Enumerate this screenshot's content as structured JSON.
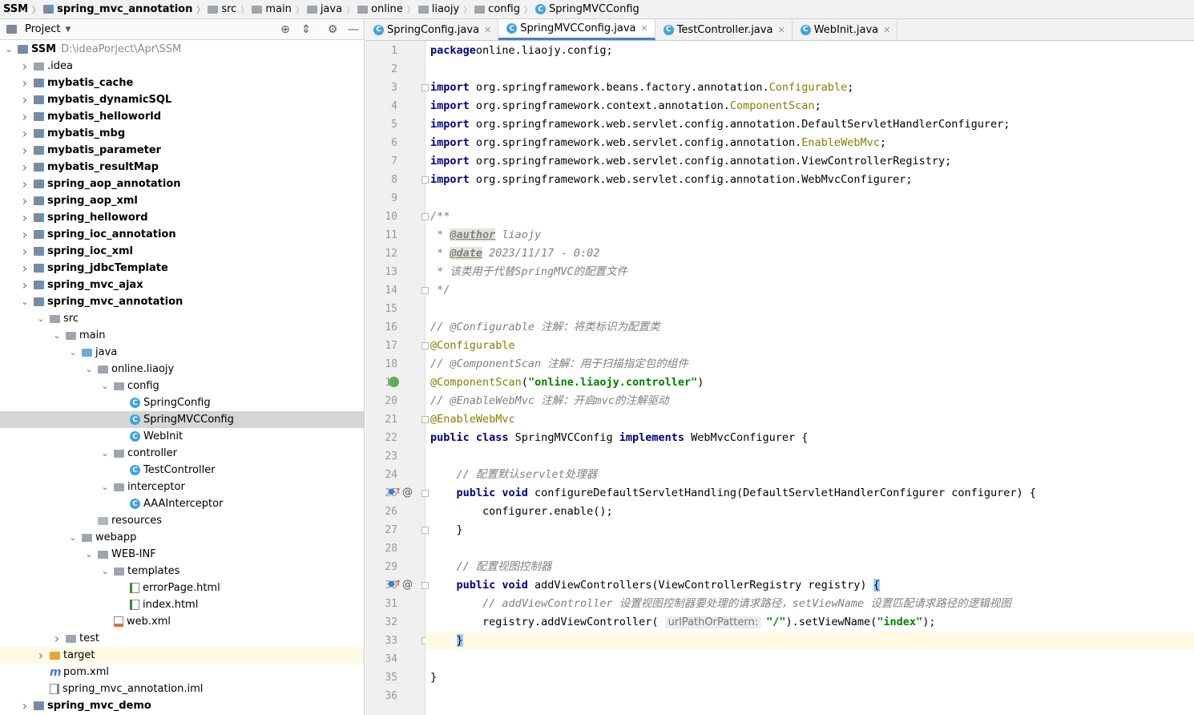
{
  "breadcrumb": [
    "SSM",
    "spring_mvc_annotation",
    "src",
    "main",
    "java",
    "online",
    "liaojy",
    "config",
    "SpringMVCConfig"
  ],
  "project_panel": {
    "title": "Project"
  },
  "tree": [
    {
      "label": "SSM",
      "path": "D:\\ideaPorject\\Apr\\SSM",
      "depth": 0,
      "expand": "open",
      "icon": "module",
      "bold": true
    },
    {
      "label": ".idea",
      "depth": 1,
      "expand": "closed",
      "icon": "folder"
    },
    {
      "label": "mybatis_cache",
      "depth": 1,
      "expand": "closed",
      "icon": "module",
      "bold": true
    },
    {
      "label": "mybatis_dynamicSQL",
      "depth": 1,
      "expand": "closed",
      "icon": "module",
      "bold": true
    },
    {
      "label": "mybatis_helloworld",
      "depth": 1,
      "expand": "closed",
      "icon": "module",
      "bold": true
    },
    {
      "label": "mybatis_mbg",
      "depth": 1,
      "expand": "closed",
      "icon": "module",
      "bold": true
    },
    {
      "label": "mybatis_parameter",
      "depth": 1,
      "expand": "closed",
      "icon": "module",
      "bold": true
    },
    {
      "label": "mybatis_resultMap",
      "depth": 1,
      "expand": "closed",
      "icon": "module",
      "bold": true
    },
    {
      "label": "spring_aop_annotation",
      "depth": 1,
      "expand": "closed",
      "icon": "module",
      "bold": true
    },
    {
      "label": "spring_aop_xml",
      "depth": 1,
      "expand": "closed",
      "icon": "module",
      "bold": true
    },
    {
      "label": "spring_helloword",
      "depth": 1,
      "expand": "closed",
      "icon": "module",
      "bold": true
    },
    {
      "label": "spring_ioc_annotation",
      "depth": 1,
      "expand": "closed",
      "icon": "module",
      "bold": true
    },
    {
      "label": "spring_ioc_xml",
      "depth": 1,
      "expand": "closed",
      "icon": "module",
      "bold": true
    },
    {
      "label": "spring_jdbcTemplate",
      "depth": 1,
      "expand": "closed",
      "icon": "module",
      "bold": true
    },
    {
      "label": "spring_mvc_ajax",
      "depth": 1,
      "expand": "closed",
      "icon": "module",
      "bold": true
    },
    {
      "label": "spring_mvc_annotation",
      "depth": 1,
      "expand": "open",
      "icon": "module",
      "bold": true
    },
    {
      "label": "src",
      "depth": 2,
      "expand": "open",
      "icon": "folder"
    },
    {
      "label": "main",
      "depth": 3,
      "expand": "open",
      "icon": "folder"
    },
    {
      "label": "java",
      "depth": 4,
      "expand": "open",
      "icon": "folder-blue"
    },
    {
      "label": "online.liaojy",
      "depth": 5,
      "expand": "open",
      "icon": "package"
    },
    {
      "label": "config",
      "depth": 6,
      "expand": "open",
      "icon": "package"
    },
    {
      "label": "SpringConfig",
      "depth": 7,
      "expand": "none",
      "icon": "class"
    },
    {
      "label": "SpringMVCConfig",
      "depth": 7,
      "expand": "none",
      "icon": "class",
      "selected": true
    },
    {
      "label": "WebInit",
      "depth": 7,
      "expand": "none",
      "icon": "class"
    },
    {
      "label": "controller",
      "depth": 6,
      "expand": "open",
      "icon": "package"
    },
    {
      "label": "TestController",
      "depth": 7,
      "expand": "none",
      "icon": "class"
    },
    {
      "label": "interceptor",
      "depth": 6,
      "expand": "open",
      "icon": "package"
    },
    {
      "label": "AAAInterceptor",
      "depth": 7,
      "expand": "none",
      "icon": "class"
    },
    {
      "label": "resources",
      "depth": 5,
      "expand": "none",
      "icon": "folder-res"
    },
    {
      "label": "webapp",
      "depth": 4,
      "expand": "open",
      "icon": "folder-web"
    },
    {
      "label": "WEB-INF",
      "depth": 5,
      "expand": "open",
      "icon": "folder"
    },
    {
      "label": "templates",
      "depth": 6,
      "expand": "open",
      "icon": "folder"
    },
    {
      "label": "errorPage.html",
      "depth": 7,
      "expand": "none",
      "icon": "html"
    },
    {
      "label": "index.html",
      "depth": 7,
      "expand": "none",
      "icon": "html"
    },
    {
      "label": "web.xml",
      "depth": 6,
      "expand": "none",
      "icon": "xml"
    },
    {
      "label": "test",
      "depth": 3,
      "expand": "closed",
      "icon": "folder"
    },
    {
      "label": "target",
      "depth": 2,
      "expand": "closed",
      "icon": "folder-orange",
      "highlight": true
    },
    {
      "label": "pom.xml",
      "depth": 2,
      "expand": "none",
      "icon": "maven"
    },
    {
      "label": "spring_mvc_annotation.iml",
      "depth": 2,
      "expand": "none",
      "icon": "iml"
    },
    {
      "label": "spring_mvc_demo",
      "depth": 1,
      "expand": "closed",
      "icon": "module",
      "bold": true
    }
  ],
  "tabs": [
    {
      "label": "SpringConfig.java",
      "active": false
    },
    {
      "label": "SpringMVCConfig.java",
      "active": true
    },
    {
      "label": "TestController.java",
      "active": false
    },
    {
      "label": "WebInit.java",
      "active": false
    }
  ],
  "editor": {
    "current_line": 33,
    "gutter_marks": {
      "19": "bean-icon",
      "25": "override-at-icon",
      "30": "override-at-icon"
    },
    "fold_lines": [
      3,
      8,
      10,
      14,
      17,
      21,
      25,
      27,
      30,
      33
    ],
    "lines": [
      [
        [
          "kw",
          "package"
        ],
        [
          "",
          "online.liaojy.config;"
        ]
      ],
      [],
      [
        [
          "kw",
          "import"
        ],
        [
          "",
          " org.springframework.beans.factory.annotation."
        ],
        [
          "an",
          "Configurable"
        ],
        [
          "",
          ";"
        ]
      ],
      [
        [
          "kw",
          "import"
        ],
        [
          "",
          " org.springframework.context.annotation."
        ],
        [
          "an",
          "ComponentScan"
        ],
        [
          "",
          ";"
        ]
      ],
      [
        [
          "kw",
          "import"
        ],
        [
          "",
          " org.springframework.web.servlet.config.annotation.DefaultServletHandlerConfigurer;"
        ]
      ],
      [
        [
          "kw",
          "import"
        ],
        [
          "",
          " org.springframework.web.servlet.config.annotation."
        ],
        [
          "an",
          "EnableWebMvc"
        ],
        [
          "",
          ";"
        ]
      ],
      [
        [
          "kw",
          "import"
        ],
        [
          "",
          " org.springframework.web.servlet.config.annotation.ViewControllerRegistry;"
        ]
      ],
      [
        [
          "kw",
          "import"
        ],
        [
          "",
          " org.springframework.web.servlet.config.annotation.WebMvcConfigurer;"
        ]
      ],
      [],
      [
        [
          "cm",
          "/**"
        ]
      ],
      [
        [
          "cm",
          " * "
        ],
        [
          "doctag",
          "@author"
        ],
        [
          "cm",
          " liaojy"
        ]
      ],
      [
        [
          "cm",
          " * "
        ],
        [
          "doctag",
          "@date"
        ],
        [
          "cm",
          " 2023/11/17 - 0:02"
        ]
      ],
      [
        [
          "cm",
          " * 该类用于代替SpringMVC的配置文件"
        ]
      ],
      [
        [
          "cm",
          " */"
        ]
      ],
      [],
      [
        [
          "cm",
          "// @Configurable 注解：将类标识为配置类"
        ]
      ],
      [
        [
          "an",
          "@Configurable"
        ]
      ],
      [
        [
          "cm",
          "// @ComponentScan 注解：用于扫描指定包的组件"
        ]
      ],
      [
        [
          "an",
          "@ComponentScan"
        ],
        [
          "",
          "("
        ],
        [
          "str",
          "\"online.liaojy.controller\""
        ],
        [
          "",
          ")"
        ]
      ],
      [
        [
          "cm",
          "// @EnableWebMvc 注解：开启mvc的注解驱动"
        ]
      ],
      [
        [
          "an",
          "@EnableWebMvc"
        ]
      ],
      [
        [
          "kw",
          "public class"
        ],
        [
          "",
          " SpringMVCConfig "
        ],
        [
          "kw",
          "implements"
        ],
        [
          "",
          " WebMvcConfigurer {"
        ]
      ],
      [],
      [
        [
          "",
          "    "
        ],
        [
          "cm",
          "// 配置默认servlet处理器"
        ]
      ],
      [
        [
          "",
          "    "
        ],
        [
          "kw",
          "public void"
        ],
        [
          "",
          " configureDefaultServletHandling(DefaultServletHandlerConfigurer configurer) {"
        ]
      ],
      [
        [
          "",
          "        configurer.enable();"
        ]
      ],
      [
        [
          "",
          "    }"
        ]
      ],
      [],
      [
        [
          "",
          "    "
        ],
        [
          "cm",
          "// 配置视图控制器"
        ]
      ],
      [
        [
          "",
          "    "
        ],
        [
          "kw",
          "public void"
        ],
        [
          "",
          " addViewControllers(ViewControllerRegistry registry) "
        ],
        [
          "brace",
          "{"
        ]
      ],
      [
        [
          "",
          "        "
        ],
        [
          "cm",
          "// addViewController 设置视图控制器要处理的请求路径，setViewName 设置匹配请求路径的逻辑视图"
        ]
      ],
      [
        [
          "",
          "        registry.addViewController( "
        ],
        [
          "hint",
          "urlPathOrPattern:"
        ],
        [
          "str",
          "\"/\""
        ],
        [
          "",
          ").setViewName("
        ],
        [
          "str",
          "\"index\""
        ],
        [
          "",
          ");"
        ]
      ],
      [
        [
          "",
          "    "
        ],
        [
          "brace",
          "}"
        ]
      ],
      [],
      [
        [
          "",
          "}"
        ]
      ],
      []
    ]
  }
}
